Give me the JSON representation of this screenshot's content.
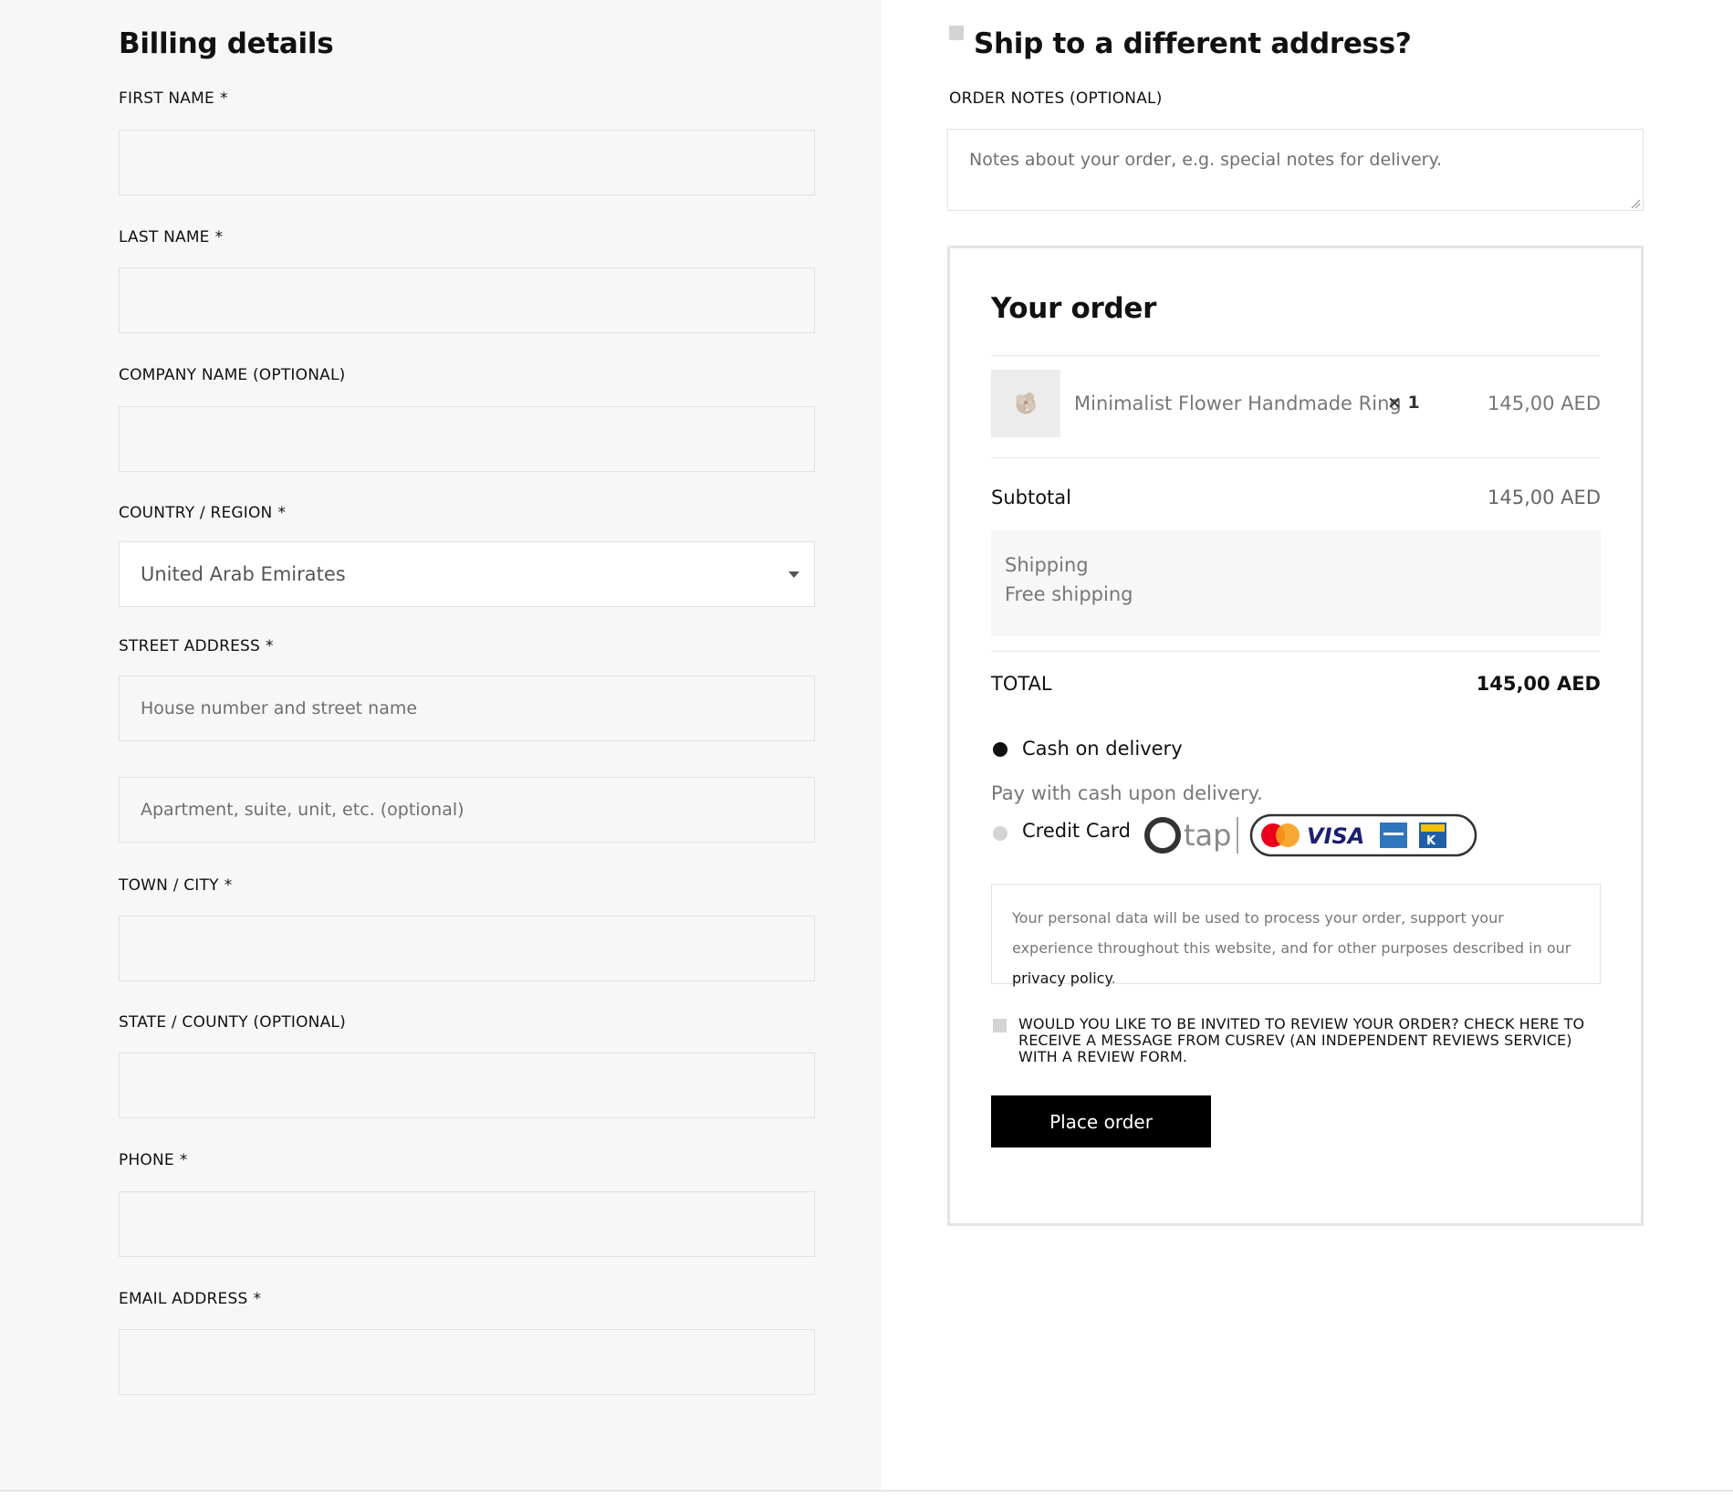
{
  "billing": {
    "title": "Billing details",
    "required_mark": "*",
    "fields": [
      {
        "label": "FIRST NAME",
        "required": true,
        "value": "",
        "placeholder": ""
      },
      {
        "label": "LAST NAME",
        "required": true,
        "value": "",
        "placeholder": ""
      },
      {
        "label": "COMPANY NAME (OPTIONAL)",
        "required": false,
        "value": "",
        "placeholder": ""
      },
      {
        "label": "COUNTRY / REGION",
        "required": true,
        "value": "United Arab Emirates"
      },
      {
        "label": "STREET ADDRESS",
        "required": true,
        "placeholder": "House number and street name",
        "placeholder2": "Apartment, suite, unit, etc. (optional)"
      },
      {
        "label": "TOWN / CITY",
        "required": true,
        "value": "",
        "placeholder": ""
      },
      {
        "label": "STATE / COUNTY (OPTIONAL)",
        "required": false,
        "value": "",
        "placeholder": ""
      },
      {
        "label": "PHONE",
        "required": true,
        "value": "",
        "placeholder": ""
      },
      {
        "label": "EMAIL ADDRESS",
        "required": true,
        "value": "",
        "placeholder": ""
      }
    ]
  },
  "shipping_toggle": {
    "label": "Ship to a different address?",
    "checked": false
  },
  "order_notes": {
    "label": "ORDER NOTES (OPTIONAL)",
    "placeholder": "Notes about your order, e.g. special notes for delivery."
  },
  "order": {
    "title": "Your order",
    "item": {
      "name": "Minimalist Flower Handmade Ring",
      "qty": "× 1",
      "price": "145,00 AED"
    },
    "subtotal_label": "Subtotal",
    "subtotal_value": "145,00 AED",
    "shipping_label": "Shipping",
    "shipping_value": "Free shipping",
    "total_label": "TOTAL",
    "total_value": "145,00 AED"
  },
  "payment": {
    "methods": [
      {
        "label": "Cash on delivery",
        "selected": true,
        "description": "Pay with cash upon delivery."
      },
      {
        "label": "Credit Card",
        "selected": false
      }
    ],
    "tap_logo_text": "tap",
    "card_brands": [
      "mastercard-icon",
      "visa-icon",
      "amex-icon",
      "knet-icon"
    ],
    "visa_text": "VISA",
    "knet_text": "K"
  },
  "privacy": {
    "text": "Your personal data will be used to process your order, support your experience throughout this website, and for other purposes described in our ",
    "link": "privacy policy",
    "suffix": "."
  },
  "review_optin": {
    "text": "WOULD YOU LIKE TO BE INVITED TO REVIEW YOUR ORDER? CHECK HERE TO RECEIVE A MESSAGE FROM CUSREV (AN INDEPENDENT REVIEWS SERVICE) WITH A REVIEW FORM.",
    "checked": false
  },
  "place_order_label": "Place order",
  "colors": {
    "panel_bg": "#f7f7f7",
    "border": "#e2e2e2",
    "button_bg": "#000000",
    "visa_blue": "#1a1f71",
    "amex_blue": "#2e77bc",
    "mc_red": "#eb001b",
    "mc_orange": "#f79e1b"
  }
}
